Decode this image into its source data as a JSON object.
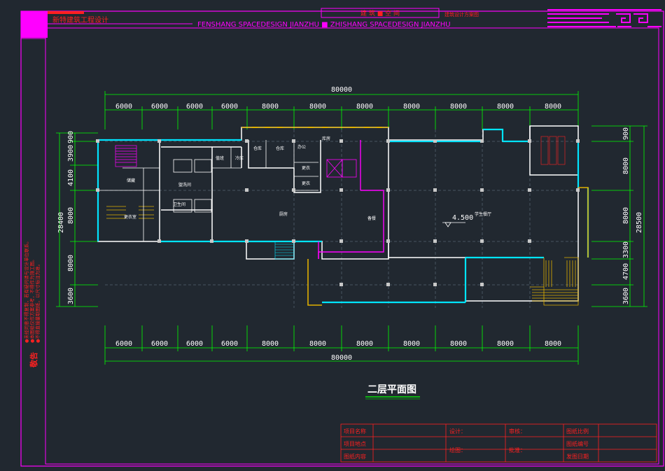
{
  "title_bar": {
    "company": "新特建筑工程设计",
    "center_title": "建 筑 ■ 空 间",
    "subtitle": "建筑设计方案图",
    "english": "FENSHANG  SPACEDESIGN JIANZHU ■ ZHISHANG  SPACEDESIGN JIANZHU"
  },
  "side_notes": {
    "label": "敬告",
    "lines": [
      "●未经同意不得复制，若有疑问请与设计单位联系。",
      "●本图纸仅作方案参考，不得作为施工图。",
      "●不得直接量取图纸，以尺寸标注为准。"
    ]
  },
  "drawing": {
    "title": "二层平面图",
    "top_total": "80000",
    "bottom_total": "80000",
    "top_dims": [
      "6000",
      "6000",
      "6000",
      "6000",
      "8000",
      "8000",
      "8000",
      "8000",
      "8000",
      "8000"
    ],
    "bottom_dims": [
      "6000",
      "6000",
      "6000",
      "6000",
      "8000",
      "8000",
      "8000",
      "8000",
      "8000",
      "8000"
    ],
    "left_dims": [
      "900",
      "3900",
      "4100",
      "8000",
      "8000",
      "3600"
    ],
    "left_total": "28400",
    "right_dims": [
      "900",
      "8000",
      "8000",
      "3300",
      "4700",
      "3600"
    ],
    "right_total": "28500",
    "level": "4.500",
    "rooms": {
      "kitchen": "厨房",
      "dining": "学生餐厅",
      "storage": "备餐",
      "office": "办公",
      "toilet": "卫生间",
      "locker": "更衣室",
      "washroom": "盥洗间",
      "store1": "仓库",
      "store2": "仓库",
      "duty": "值班",
      "change1": "更衣",
      "change2": "更衣",
      "room_a": "冷库",
      "room_b": "库房",
      "room_c": "储藏"
    }
  },
  "title_block": {
    "project_name": "项目名称",
    "project_address": "项目地点",
    "drawing_content": "图纸内容",
    "design": "设计：",
    "review": "审核：",
    "drawing": "绘图：",
    "approve": "批准：",
    "scale": "图纸比例",
    "number": "图纸编号",
    "date": "发图日期"
  },
  "colors": {
    "background": "#212830",
    "frame": "#ff00ff",
    "red": "#ff2020",
    "wall": "#00e5ff",
    "stair": "#e0b000",
    "dim": "#00ff00",
    "line": "#ffffff"
  }
}
